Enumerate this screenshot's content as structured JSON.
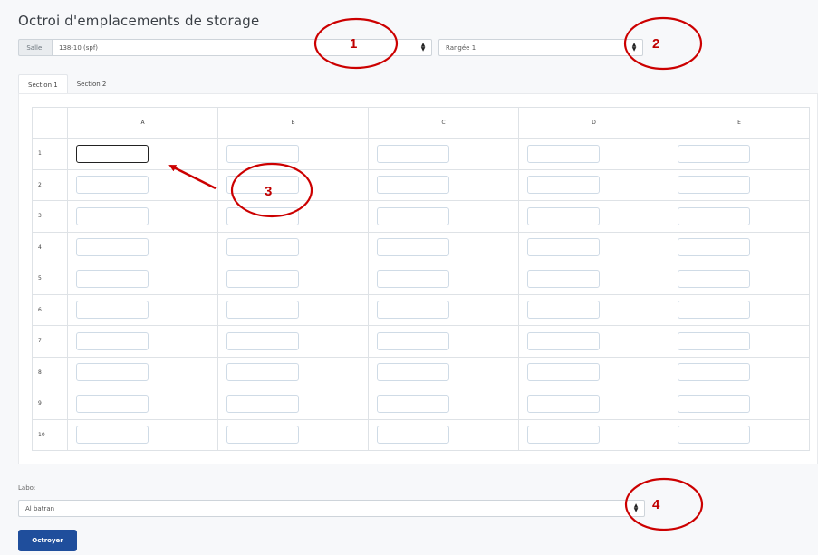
{
  "page": {
    "title": "Octroi d'emplacements de storage"
  },
  "salle": {
    "label": "Salle:",
    "value": "138-10 (spf)"
  },
  "rangee": {
    "value": "Rangée 1"
  },
  "tabs": [
    {
      "label": "Section 1",
      "active": true
    },
    {
      "label": "Section 2",
      "active": false
    }
  ],
  "grid": {
    "columns": [
      "A",
      "B",
      "C",
      "D",
      "E"
    ],
    "rows": [
      "1",
      "2",
      "3",
      "4",
      "5",
      "6",
      "7",
      "8",
      "9",
      "10"
    ],
    "focused_cell": {
      "row": "1",
      "column": "A"
    }
  },
  "labo": {
    "label": "Labo:",
    "value": "Al batran"
  },
  "submit": {
    "label": "Octroyer"
  },
  "annotations": [
    {
      "number": "1",
      "target": "salle-select"
    },
    {
      "number": "2",
      "target": "rangee-select"
    },
    {
      "number": "3",
      "target": "grid-cell-1-A"
    },
    {
      "number": "4",
      "target": "labo-select"
    }
  ],
  "colors": {
    "primary": "#1f4e9c",
    "annotation": "#cc0000"
  }
}
